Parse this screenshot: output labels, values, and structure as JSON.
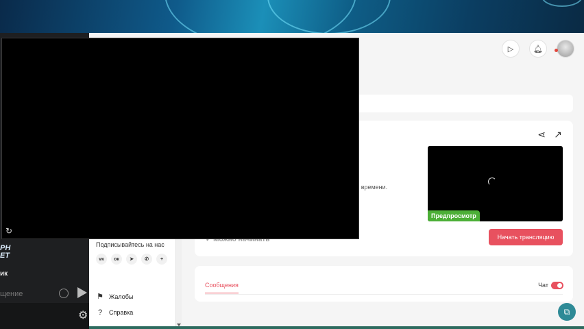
{
  "left_app": {
    "brand": "РН\nЕТ",
    "label": "ик",
    "message_placeholder": "щение",
    "emoji_icon": "smile-icon",
    "send_icon": "send-icon",
    "settings_icon": "gear-icon"
  },
  "header": {
    "play_icon": "play-icon",
    "notification_icon": "bell-icon",
    "avatar_icon": "avatar-icon"
  },
  "stream": {
    "description_fragment": "м времени.",
    "preview_badge": "Предпросмотр",
    "ready_text": "Можно начинать",
    "start_button": "Начать трансляцию",
    "share_icon": "share-icon",
    "open_icon": "external-link-icon"
  },
  "chat": {
    "tab_messages": "Сообщения",
    "chat_label": "Чат",
    "chat_enabled": true
  },
  "sidebar": {
    "subscribe_title": "Подписывайтесь на нас",
    "socials": [
      "vk",
      "ok",
      "telegram",
      "viber",
      "more"
    ],
    "social_glyphs": [
      "ᴠᴋ",
      "ок",
      "➤",
      "✆",
      "+"
    ],
    "items": [
      {
        "label": "Жалобы",
        "icon": "flag-icon",
        "glyph": "⚑"
      },
      {
        "label": "Справка",
        "icon": "help-icon",
        "glyph": "?"
      }
    ]
  },
  "player": {
    "refresh_icon": "refresh-icon"
  },
  "colors": {
    "accent": "#e8515f",
    "preview_badge": "#4caf37",
    "fab": "#2e8a96"
  }
}
